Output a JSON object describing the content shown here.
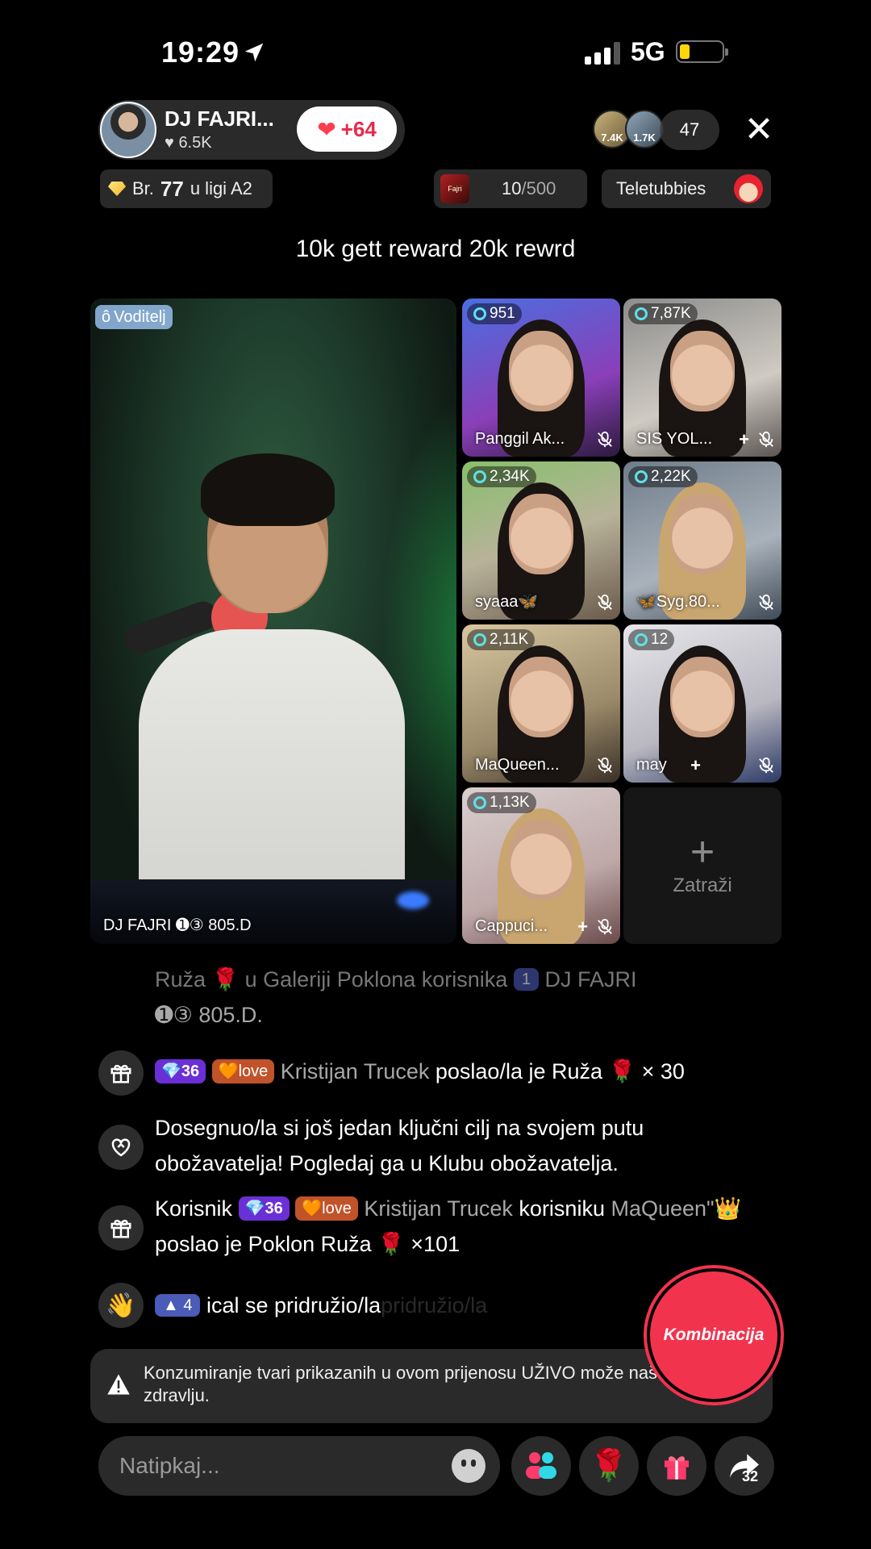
{
  "status": {
    "time": "19:29",
    "network": "5G"
  },
  "host": {
    "name": "DJ FAJRI...",
    "likes": "6.5K",
    "follow_count": "+64"
  },
  "viewers": {
    "avatars": [
      {
        "count": "7.4K"
      },
      {
        "count": "1.7K"
      }
    ],
    "total": "47"
  },
  "league": {
    "prefix": "Br.",
    "rank": "77",
    "suffix": "u ligi A2"
  },
  "goal": {
    "thumb_text": "Fajri",
    "current": "10",
    "target": "/500"
  },
  "teletubbies": {
    "label": "Teletubbies"
  },
  "announcement": "10k gett reward 20k rewrd",
  "host_video": {
    "badge": "Voditelj",
    "label": "DJ FAJRI ➊③ 805.D"
  },
  "guests": [
    {
      "count": "951",
      "name": "Panggil Ak...",
      "has_plus": false
    },
    {
      "count": "7,87K",
      "name": "SIS YOL...",
      "has_plus": true
    },
    {
      "count": "2,34K",
      "name": "syaaa🦋",
      "has_plus": false
    },
    {
      "count": "2,22K",
      "name": "🦋Syg.80...",
      "has_plus": false
    },
    {
      "count": "2,11K",
      "name": "MaQueen...",
      "has_plus": false
    },
    {
      "count": "12",
      "name": "may",
      "has_plus": true
    },
    {
      "count": "1,13K",
      "name": "Cappuci...",
      "has_plus": true
    }
  ],
  "request_slot": {
    "label": "Zatraži"
  },
  "chat": [
    {
      "line1_a": "Ruža 🌹 u Galeriji Poklona korisnika",
      "badge_lvl": "1",
      "line1_b": "DJ FAJRI",
      "line2": "➊③ 805.D."
    },
    {
      "gem": "36",
      "love": "love",
      "user": "Kristijan Trucek",
      "text": "poslao/la je Ruža 🌹 × 30"
    },
    {
      "text": "Dosegnuo/la si još jedan ključni cilj na svojem putu obožavatelja! Pogledaj ga u Klubu obožavatelja."
    },
    {
      "prefix": "Korisnik",
      "gem": "36",
      "love": "love",
      "user": "Kristijan Trucek",
      "mid": "korisniku",
      "target": "MaQueen\"👑",
      "text": "poslao je Poklon Ruža 🌹 ×101"
    },
    {
      "badge_lvl": "4",
      "text": "ical se pridružio/la",
      "ghost": "pridružio/la"
    }
  ],
  "combo_button": "Kombinacija",
  "warning": "Konzumiranje tvari prikazanih u ovom prijenosu UŽIVO može naštetiti zdravlju.",
  "comment": {
    "placeholder": "Natipkaj..."
  },
  "share": {
    "count": "32"
  },
  "colors": {
    "accent": "#f2334e",
    "gem_badge": "#6b2fd6",
    "love_badge": "#c0532a",
    "battery": "#ffd60a"
  }
}
